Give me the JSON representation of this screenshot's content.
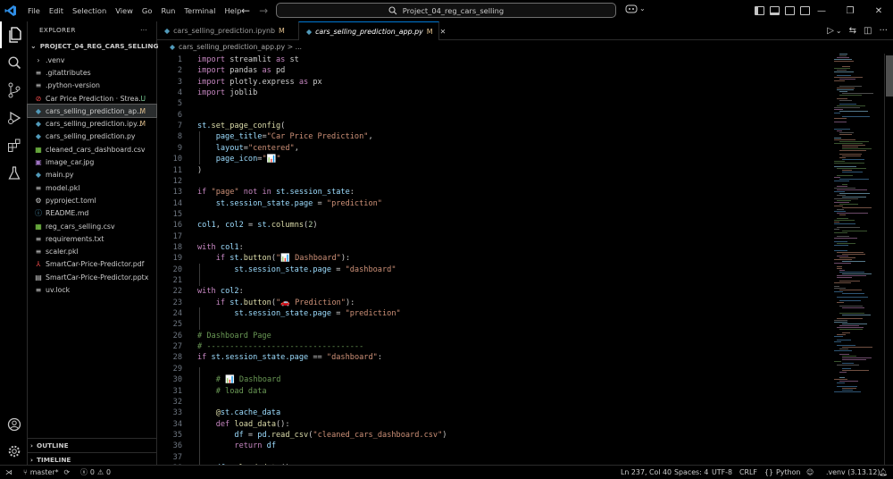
{
  "titlebar": {
    "menu": [
      "File",
      "Edit",
      "Selection",
      "View",
      "Go",
      "Run",
      "Terminal",
      "Help"
    ],
    "search_text": "Project_04_reg_cars_selling"
  },
  "explorer": {
    "title": "EXPLORER",
    "project": "PROJECT_04_REG_CARS_SELLING",
    "files": [
      {
        "icon": "chevron-right-icon",
        "glyph": "›",
        "color": "#cccccc",
        "name": ".venv",
        "badge": "",
        "badge_color": ""
      },
      {
        "icon": "git-icon",
        "glyph": "≡",
        "color": "#cccccc",
        "name": ".gitattributes",
        "badge": "",
        "badge_color": ""
      },
      {
        "icon": "text-file-icon",
        "glyph": "≡",
        "color": "#cccccc",
        "name": ".python-version",
        "badge": "",
        "badge_color": ""
      },
      {
        "icon": "streamlit-icon",
        "glyph": "⊘",
        "color": "#f14c4c",
        "name": "Car Price Prediction · Strea...",
        "badge": "U",
        "badge_color": "#73c991"
      },
      {
        "icon": "python-icon",
        "glyph": "◆",
        "color": "#519aba",
        "name": "cars_selling_prediction_ap...",
        "badge": "M",
        "badge_color": "#e2c08d"
      },
      {
        "icon": "python-icon",
        "glyph": "◆",
        "color": "#519aba",
        "name": "cars_selling_prediction.ipy...",
        "badge": "M",
        "badge_color": "#e2c08d"
      },
      {
        "icon": "python-icon",
        "glyph": "◆",
        "color": "#519aba",
        "name": "cars_selling_prediction.py",
        "badge": "",
        "badge_color": ""
      },
      {
        "icon": "csv-icon",
        "glyph": "▦",
        "color": "#89e051",
        "name": "cleaned_cars_dashboard.csv",
        "badge": "",
        "badge_color": ""
      },
      {
        "icon": "image-icon",
        "glyph": "▣",
        "color": "#a074c4",
        "name": "image_car.jpg",
        "badge": "",
        "badge_color": ""
      },
      {
        "icon": "python-icon",
        "glyph": "◆",
        "color": "#519aba",
        "name": "main.py",
        "badge": "",
        "badge_color": ""
      },
      {
        "icon": "file-icon",
        "glyph": "≡",
        "color": "#cccccc",
        "name": "model.pkl",
        "badge": "",
        "badge_color": ""
      },
      {
        "icon": "settings-file-icon",
        "glyph": "⚙",
        "color": "#cccccc",
        "name": "pyproject.toml",
        "badge": "",
        "badge_color": ""
      },
      {
        "icon": "info-icon",
        "glyph": "ⓘ",
        "color": "#519aba",
        "name": "README.md",
        "badge": "",
        "badge_color": ""
      },
      {
        "icon": "csv-icon",
        "glyph": "▦",
        "color": "#89e051",
        "name": "reg_cars_selling.csv",
        "badge": "",
        "badge_color": ""
      },
      {
        "icon": "text-file-icon",
        "glyph": "≡",
        "color": "#cccccc",
        "name": "requirements.txt",
        "badge": "",
        "badge_color": ""
      },
      {
        "icon": "file-icon",
        "glyph": "≡",
        "color": "#cccccc",
        "name": "scaler.pkl",
        "badge": "",
        "badge_color": ""
      },
      {
        "icon": "pdf-icon",
        "glyph": "⅄",
        "color": "#f14c4c",
        "name": "SmartCar-Price-Predictor.pdf",
        "badge": "",
        "badge_color": ""
      },
      {
        "icon": "pptx-icon",
        "glyph": "▤",
        "color": "#cccccc",
        "name": "SmartCar-Price-Predictor.pptx",
        "badge": "",
        "badge_color": ""
      },
      {
        "icon": "lock-file-icon",
        "glyph": "≡",
        "color": "#cccccc",
        "name": "uv.lock",
        "badge": "",
        "badge_color": ""
      }
    ],
    "outline": "OUTLINE",
    "timeline": "TIMELINE"
  },
  "tabs": [
    {
      "name": "cars_selling_prediction.ipynb",
      "badge": "M"
    },
    {
      "name": "cars_selling_prediction_app.py",
      "badge": "M"
    }
  ],
  "breadcrumb": "cars_selling_prediction_app.py > ...",
  "code": [
    [
      [
        "import",
        "kw"
      ],
      [
        " streamlit ",
        ""
      ],
      [
        "as",
        "kw"
      ],
      [
        " st",
        ""
      ]
    ],
    [
      [
        "import",
        "kw"
      ],
      [
        " pandas ",
        ""
      ],
      [
        "as",
        "kw"
      ],
      [
        " pd",
        ""
      ]
    ],
    [
      [
        "import",
        "kw"
      ],
      [
        " plotly.express ",
        ""
      ],
      [
        "as",
        "kw"
      ],
      [
        " px",
        ""
      ]
    ],
    [
      [
        "import",
        "kw"
      ],
      [
        " joblib",
        ""
      ]
    ],
    [],
    [],
    [
      [
        "st.",
        "vr"
      ],
      [
        "set_page_config",
        "fn"
      ],
      [
        "(",
        ""
      ]
    ],
    [
      [
        "    page_title",
        "vr"
      ],
      [
        "=",
        ""
      ],
      [
        "\"Car Price Prediction\"",
        "st-s"
      ],
      [
        ",",
        ""
      ]
    ],
    [
      [
        "    layout",
        "vr"
      ],
      [
        "=",
        ""
      ],
      [
        "\"centered\"",
        "st-s"
      ],
      [
        ",",
        ""
      ]
    ],
    [
      [
        "    page_icon",
        "vr"
      ],
      [
        "=",
        ""
      ],
      [
        "\"📊\"",
        "st-s"
      ]
    ],
    [
      [
        ")",
        ""
      ]
    ],
    [],
    [
      [
        "if",
        "kw"
      ],
      [
        " ",
        ""
      ],
      [
        "\"page\"",
        "st-s"
      ],
      [
        " not in ",
        "kw"
      ],
      [
        "st.session_state",
        "vr"
      ],
      [
        ":",
        ""
      ]
    ],
    [
      [
        "    st.session_state.page",
        "vr"
      ],
      [
        " = ",
        ""
      ],
      [
        "\"prediction\"",
        "st-s"
      ]
    ],
    [],
    [
      [
        "col1",
        "vr"
      ],
      [
        ", ",
        ""
      ],
      [
        "col2",
        "vr"
      ],
      [
        " = ",
        ""
      ],
      [
        "st.",
        "vr"
      ],
      [
        "columns",
        "fn"
      ],
      [
        "(",
        ""
      ],
      [
        "2",
        "nm"
      ],
      [
        ")",
        ""
      ]
    ],
    [],
    [
      [
        "with",
        "kw"
      ],
      [
        " ",
        ""
      ],
      [
        "col1",
        "vr"
      ],
      [
        ":",
        ""
      ]
    ],
    [
      [
        "    ",
        ""
      ],
      [
        "if",
        "kw"
      ],
      [
        " ",
        ""
      ],
      [
        "st.",
        "vr"
      ],
      [
        "button",
        "fn"
      ],
      [
        "(",
        ""
      ],
      [
        "\"📊 Dashboard\"",
        "st-s"
      ],
      [
        "):",
        ""
      ]
    ],
    [
      [
        "        st.session_state.page",
        "vr"
      ],
      [
        " = ",
        ""
      ],
      [
        "\"dashboard\"",
        "st-s"
      ]
    ],
    [],
    [
      [
        "with",
        "kw"
      ],
      [
        " ",
        ""
      ],
      [
        "col2",
        "vr"
      ],
      [
        ":",
        ""
      ]
    ],
    [
      [
        "    ",
        ""
      ],
      [
        "if",
        "kw"
      ],
      [
        " ",
        ""
      ],
      [
        "st.",
        "vr"
      ],
      [
        "button",
        "fn"
      ],
      [
        "(",
        ""
      ],
      [
        "\"🚗 Prediction\"",
        "st-s"
      ],
      [
        "):",
        ""
      ]
    ],
    [
      [
        "        st.session_state.page",
        "vr"
      ],
      [
        " = ",
        ""
      ],
      [
        "\"prediction\"",
        "st-s"
      ]
    ],
    [],
    [
      [
        "# Dashboard Page",
        "cm"
      ]
    ],
    [
      [
        "# ----------------------------------",
        "cm"
      ]
    ],
    [
      [
        "if",
        "kw"
      ],
      [
        " ",
        ""
      ],
      [
        "st.session_state.page",
        "vr"
      ],
      [
        " == ",
        ""
      ],
      [
        "\"dashboard\"",
        "st-s"
      ],
      [
        ":",
        ""
      ]
    ],
    [],
    [
      [
        "    # 📊 Dashboard",
        "cm"
      ]
    ],
    [
      [
        "    # load data",
        "cm"
      ]
    ],
    [],
    [
      [
        "    @",
        "fn"
      ],
      [
        "st.cache_data",
        "vr"
      ]
    ],
    [
      [
        "    ",
        ""
      ],
      [
        "def",
        "kw"
      ],
      [
        " ",
        ""
      ],
      [
        "load_data",
        "fn"
      ],
      [
        "():",
        ""
      ]
    ],
    [
      [
        "        df",
        "vr"
      ],
      [
        " = ",
        ""
      ],
      [
        "pd.",
        "vr"
      ],
      [
        "read_csv",
        "fn"
      ],
      [
        "(",
        ""
      ],
      [
        "\"cleaned_cars_dashboard.csv\"",
        "st-s"
      ],
      [
        ")",
        ""
      ]
    ],
    [
      [
        "        ",
        ""
      ],
      [
        "return",
        "kw"
      ],
      [
        " ",
        ""
      ],
      [
        "df",
        "vr"
      ]
    ],
    [],
    [
      [
        "    df",
        "vr"
      ],
      [
        " = ",
        ""
      ],
      [
        "load_data",
        "fn"
      ],
      [
        "()",
        ""
      ]
    ]
  ],
  "statusbar": {
    "branch": "master*",
    "errors": "0",
    "warnings": "0",
    "position": "Ln 237, Col 40",
    "spaces": "Spaces: 4",
    "encoding": "UTF-8",
    "eol": "CRLF",
    "language": "Python",
    "venv": ".venv (3.13.12)"
  },
  "colors": {
    "accent": "#0078d4",
    "modified": "#e2c08d",
    "untracked": "#73c991"
  }
}
